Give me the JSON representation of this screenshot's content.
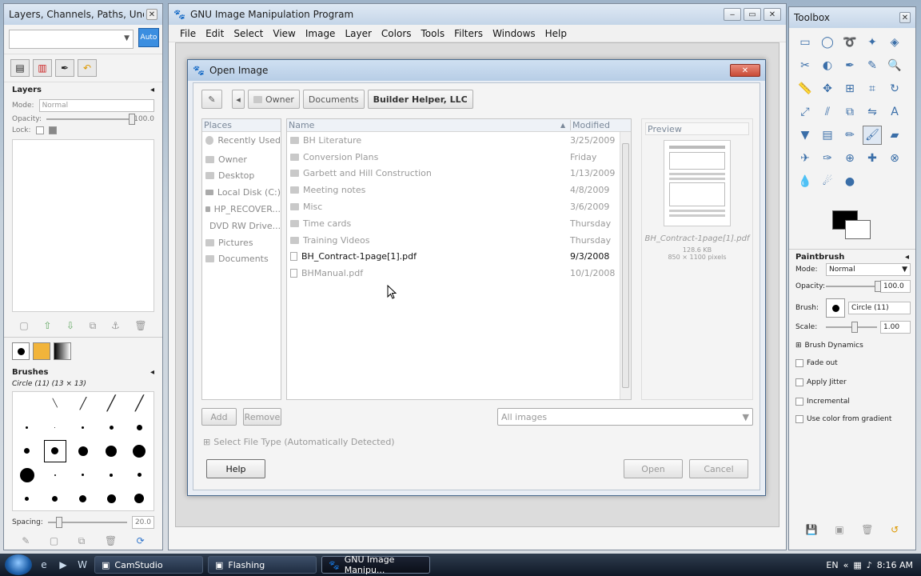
{
  "layers_dock": {
    "title": "Layers, Channels, Paths, Undo - Br...",
    "auto_label": "Auto",
    "layers_title": "Layers",
    "mode_label": "Mode:",
    "mode_value": "Normal",
    "opacity_label": "Opacity:",
    "opacity_value": "100.0",
    "lock_label": "Lock:",
    "brushes_title": "Brushes",
    "brush_name": "Circle (11) (13 × 13)",
    "spacing_label": "Spacing:",
    "spacing_value": "20.0"
  },
  "gimp": {
    "title": "GNU Image Manipulation Program",
    "menu": [
      "File",
      "Edit",
      "Select",
      "View",
      "Image",
      "Layer",
      "Colors",
      "Tools",
      "Filters",
      "Windows",
      "Help"
    ]
  },
  "toolbox": {
    "title": "Toolbox",
    "tools": [
      "rect-select-icon",
      "ellipse-select-icon",
      "lasso-icon",
      "fuzzy-select-icon",
      "color-select-icon",
      "scissors-icon",
      "foreground-select-icon",
      "paths-icon",
      "color-picker-icon",
      "zoom-icon",
      "measure-icon",
      "move-icon",
      "align-icon",
      "crop-icon",
      "rotate-icon",
      "scale-icon",
      "shear-icon",
      "perspective-icon",
      "flip-icon",
      "text-icon",
      "bucket-fill-icon",
      "blend-icon",
      "pencil-icon",
      "paintbrush-icon",
      "eraser-icon",
      "airbrush-icon",
      "ink-icon",
      "clone-icon",
      "heal-icon",
      "perspective-clone-icon",
      "blur-icon",
      "smudge-icon",
      "dodge-icon"
    ],
    "tool_glyphs": [
      "▭",
      "◯",
      "➰",
      "✦",
      "◈",
      "✂",
      "◐",
      "✒",
      "✎",
      "🔍",
      "📏",
      "✥",
      "⊞",
      "⌗",
      "↻",
      "⤢",
      "⫽",
      "⧉",
      "⇋",
      "A",
      "▼",
      "▤",
      "✏",
      "🖌",
      "▰",
      "✈",
      "✑",
      "⊕",
      "✚",
      "⊗",
      "💧",
      "☄",
      "●"
    ],
    "active_tool_index": 23,
    "paintbrush_title": "Paintbrush",
    "mode_label": "Mode:",
    "mode_value": "Normal",
    "opacity_label": "Opacity:",
    "opacity_value": "100.0",
    "brush_label": "Brush:",
    "brush_value": "Circle (11)",
    "scale_label": "Scale:",
    "scale_value": "1.00",
    "brush_dynamics": "Brush Dynamics",
    "fade_out": "Fade out",
    "apply_jitter": "Apply Jitter",
    "incremental": "Incremental",
    "use_gradient": "Use color from gradient"
  },
  "dialog": {
    "title": "Open Image",
    "path": [
      "Owner",
      "Documents",
      "Builder Helper, LLC"
    ],
    "places_header": "Places",
    "places": [
      {
        "label": "Recently Used",
        "icon": "clock-icon"
      },
      {
        "label": "Owner",
        "icon": "folder-icon"
      },
      {
        "label": "Desktop",
        "icon": "folder-icon"
      },
      {
        "label": "Local Disk (C:)",
        "icon": "drive-icon"
      },
      {
        "label": "HP_RECOVER...",
        "icon": "drive-icon"
      },
      {
        "label": "DVD RW Drive...",
        "icon": "optical-drive-icon"
      },
      {
        "label": "Pictures",
        "icon": "folder-icon"
      },
      {
        "label": "Documents",
        "icon": "folder-icon"
      }
    ],
    "name_header": "Name",
    "modified_header": "Modified",
    "files": [
      {
        "name": "BH Literature",
        "date": "3/25/2009",
        "type": "folder"
      },
      {
        "name": "Conversion Plans",
        "date": "Friday",
        "type": "folder"
      },
      {
        "name": "Garbett and Hill Construction",
        "date": "1/13/2009",
        "type": "folder"
      },
      {
        "name": "Meeting notes",
        "date": "4/8/2009",
        "type": "folder"
      },
      {
        "name": "Misc",
        "date": "3/6/2009",
        "type": "folder"
      },
      {
        "name": "Time cards",
        "date": "Thursday",
        "type": "folder"
      },
      {
        "name": "Training Videos",
        "date": "Thursday",
        "type": "folder"
      },
      {
        "name": "BH_Contract-1page[1].pdf",
        "date": "9/3/2008",
        "type": "file"
      },
      {
        "name": "BHManual.pdf",
        "date": "10/1/2008",
        "type": "file"
      }
    ],
    "preview_header": "Preview",
    "preview_filename": "BH_Contract-1page[1].pdf",
    "preview_size": "128.6 KB",
    "preview_dims": "850 × 1100 pixels",
    "add_label": "Add",
    "remove_label": "Remove",
    "filter_value": "All images",
    "select_file_type": "Select File Type (Automatically Detected)",
    "help_label": "Help",
    "open_label": "Open",
    "cancel_label": "Cancel"
  },
  "taskbar": {
    "tasks": [
      {
        "label": "CamStudio"
      },
      {
        "label": "Flashing"
      },
      {
        "label": "GNU Image Manipu..."
      }
    ],
    "language": "EN",
    "time": "8:16 AM"
  }
}
